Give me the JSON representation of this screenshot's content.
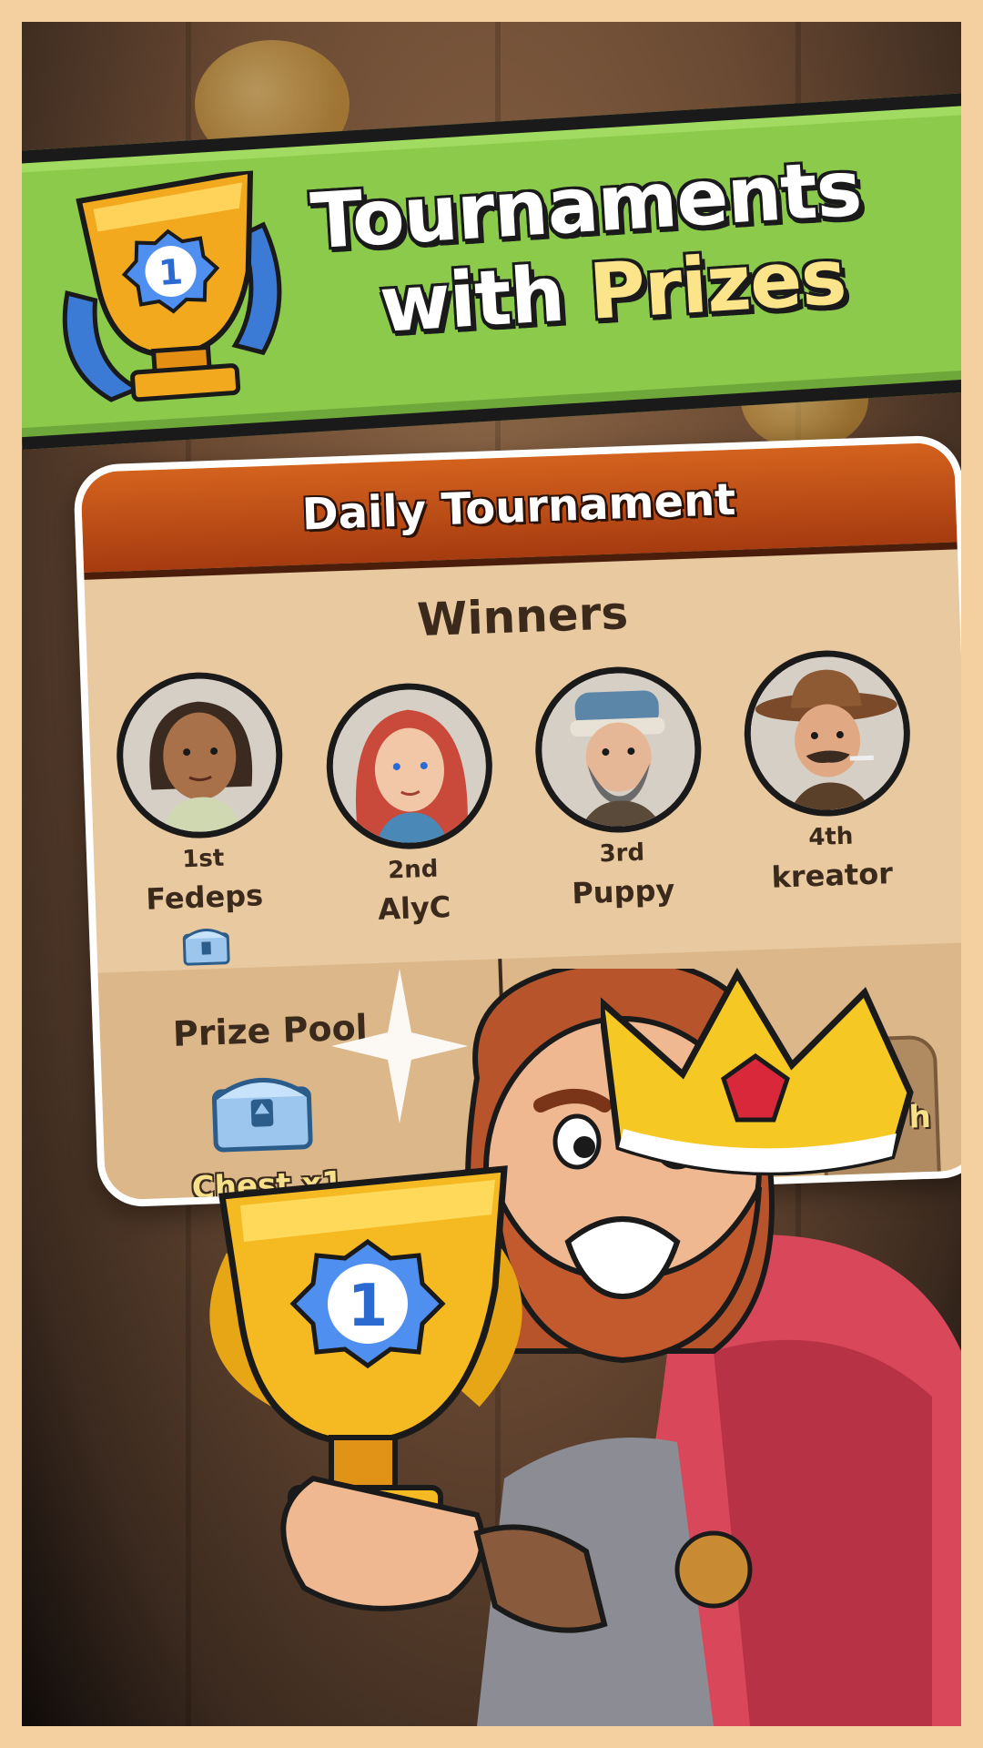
{
  "banner": {
    "headline_line1": "Tournaments",
    "headline_word2": "with",
    "headline_word3": "Prizes"
  },
  "card": {
    "title": "Daily Tournament",
    "winners_title": "Winners",
    "winners": [
      {
        "rank": "1st",
        "name": "Fedeps"
      },
      {
        "rank": "2nd",
        "name": "AlyC"
      },
      {
        "rank": "3rd",
        "name": "Puppy"
      },
      {
        "rank": "4th",
        "name": "kreator"
      }
    ],
    "prize_pool_title": "Prize Pool",
    "prize_pool_reward": "Chest x1",
    "podium_first": "1st",
    "podium_second_partial": "h"
  },
  "colors": {
    "banner_green": "#8cca4c",
    "header_orange": "#d4621e",
    "highlight_yellow": "#fbe48a"
  }
}
